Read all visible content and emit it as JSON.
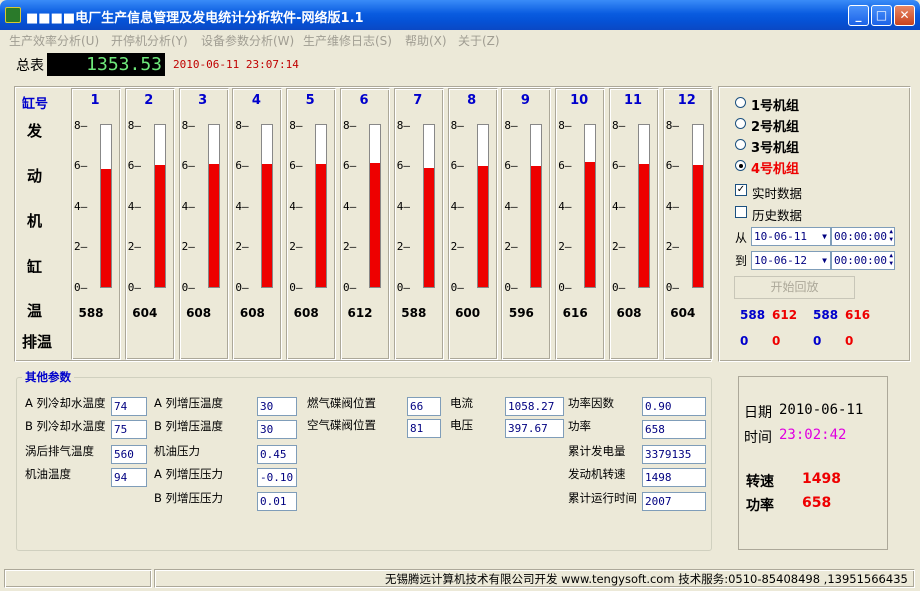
{
  "window": {
    "title": "■■■■电厂生产信息管理及发电统计分析软件-网络版1.1"
  },
  "menu": [
    "生产效率分析(U)",
    "开停机分析(Y)",
    "设备参数分析(W)",
    "生产维修日志(S)",
    "帮助(X)",
    "关于(Z)"
  ],
  "header": {
    "total_label": "总表",
    "total_value": "1353.53",
    "datetime": "2010-06-11 23:07:14"
  },
  "cylinders": {
    "head_label": "缸号",
    "side_labels": [
      "发",
      "动",
      "机",
      "缸",
      "温"
    ],
    "exhaust_label": "排温",
    "ticks": [
      "8",
      "6",
      "4",
      "2",
      "0"
    ],
    "items": [
      {
        "num": "1",
        "temp": "588",
        "level": 0.73
      },
      {
        "num": "2",
        "temp": "604",
        "level": 0.755
      },
      {
        "num": "3",
        "temp": "608",
        "level": 0.76
      },
      {
        "num": "4",
        "temp": "608",
        "level": 0.76
      },
      {
        "num": "5",
        "temp": "608",
        "level": 0.76
      },
      {
        "num": "6",
        "temp": "612",
        "level": 0.765
      },
      {
        "num": "7",
        "temp": "588",
        "level": 0.735
      },
      {
        "num": "8",
        "temp": "600",
        "level": 0.75
      },
      {
        "num": "9",
        "temp": "596",
        "level": 0.745
      },
      {
        "num": "10",
        "temp": "616",
        "level": 0.77
      },
      {
        "num": "11",
        "temp": "608",
        "level": 0.76
      },
      {
        "num": "12",
        "temp": "604",
        "level": 0.755
      }
    ]
  },
  "units": {
    "options": [
      "1号机组",
      "2号机组",
      "3号机组",
      "4号机组"
    ],
    "selected": 3,
    "realtime_label": "实时数据",
    "realtime_checked": true,
    "history_label": "历史数据",
    "history_checked": false,
    "from_label": "从",
    "from_date": "10-06-11",
    "from_time": "00:00:00",
    "to_label": "到",
    "to_date": "10-06-12",
    "to_time": "00:00:00",
    "playback_label": "开始回放",
    "row1": [
      "588",
      "612",
      "588",
      "616"
    ],
    "row2": [
      "0",
      "0",
      "0",
      "0"
    ]
  },
  "params": {
    "title": "其他参数",
    "col1": [
      {
        "label": "A 列冷却水温度",
        "value": "74"
      },
      {
        "label": "B 列冷却水温度",
        "value": "75"
      },
      {
        "label": "涡后排气温度",
        "value": "560"
      },
      {
        "label": "机油温度",
        "value": "94"
      }
    ],
    "col2": [
      {
        "label": "A 列增压温度",
        "value": "30"
      },
      {
        "label": "B 列增压温度",
        "value": "30"
      },
      {
        "label": "机油压力",
        "value": "0.45"
      },
      {
        "label": "A 列增压压力",
        "value": "-0.10"
      },
      {
        "label": "B 列增压压力",
        "value": "0.01"
      }
    ],
    "col3": [
      {
        "label": "燃气碟阀位置",
        "value": "66"
      },
      {
        "label": "空气碟阀位置",
        "value": "81"
      }
    ],
    "col4": [
      {
        "label": "电流",
        "value": "1058.27"
      },
      {
        "label": "电压",
        "value": "397.67"
      }
    ],
    "col5": [
      {
        "label": "功率因数",
        "value": "0.90"
      },
      {
        "label": "功率",
        "value": "658"
      },
      {
        "label": "累计发电量",
        "value": "3379135"
      },
      {
        "label": "发动机转速",
        "value": "1498"
      },
      {
        "label": "累计运行时间",
        "value": "2007"
      }
    ]
  },
  "summary": {
    "date_label": "日期",
    "date_value": "2010-06-11",
    "time_label": "时间",
    "time_value": "23:02:42",
    "speed_label": "转速",
    "speed_value": "1498",
    "power_label": "功率",
    "power_value": "658"
  },
  "status": {
    "text": "无锡腾远计算机技术有限公司开发 www.tengysoft.com  技术服务:0510-85408498 ,13951566435"
  }
}
